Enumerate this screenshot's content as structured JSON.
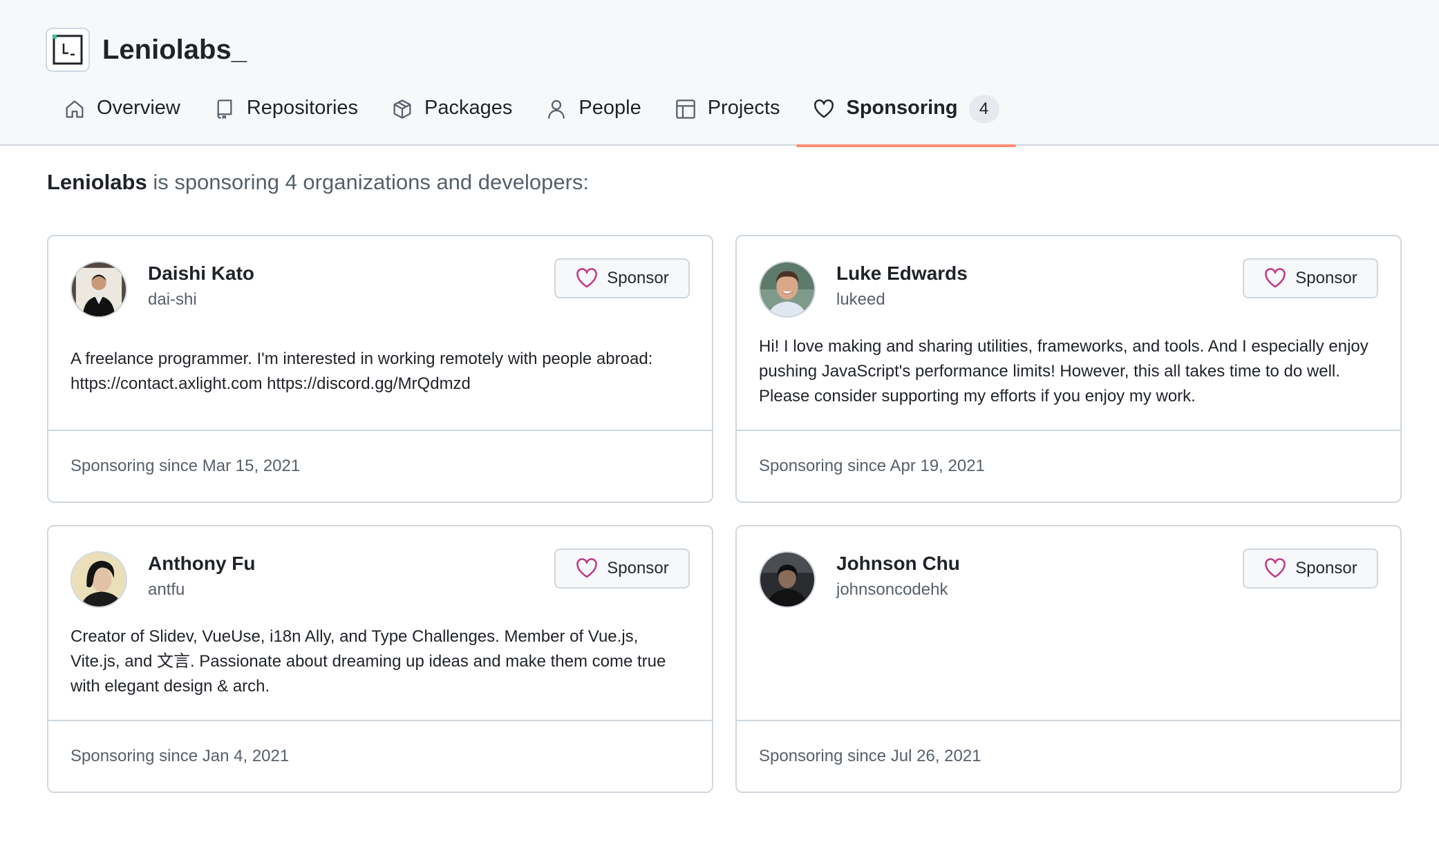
{
  "org": {
    "name": "Leniolabs_"
  },
  "tabs": [
    {
      "label": "Overview",
      "icon": "home-icon"
    },
    {
      "label": "Repositories",
      "icon": "repo-icon"
    },
    {
      "label": "Packages",
      "icon": "package-icon"
    },
    {
      "label": "People",
      "icon": "person-icon"
    },
    {
      "label": "Projects",
      "icon": "table-icon"
    },
    {
      "label": "Sponsoring",
      "icon": "heart-icon",
      "count": "4",
      "active": true
    }
  ],
  "intro": {
    "org_name": "Leniolabs",
    "text": " is sponsoring 4 organizations and developers:"
  },
  "colors": {
    "accent": "#fd8c73",
    "heart": "#bf3989",
    "muted": "#57606a"
  },
  "sponsor_button_label": "Sponsor",
  "sponsorships": [
    {
      "name": "Daishi Kato",
      "login": "dai-shi",
      "bio": "A freelance programmer. I'm interested in working remotely with people abroad: https://contact.axlight.com https://discord.gg/MrQdmzd",
      "since": "Sponsoring since Mar 15, 2021"
    },
    {
      "name": "Luke Edwards",
      "login": "lukeed",
      "bio": "Hi! I love making and sharing utilities, frameworks, and tools. And I especially enjoy pushing JavaScript's performance limits! However, this all takes time to do well. Please consider supporting my efforts if you enjoy my work.",
      "since": "Sponsoring since Apr 19, 2021"
    },
    {
      "name": "Anthony Fu",
      "login": "antfu",
      "bio": "Creator of Slidev, VueUse, i18n Ally, and Type Challenges. Member of Vue.js, Vite.js, and 文言. Passionate about dreaming up ideas and make them come true with elegant design & arch.",
      "since": "Sponsoring since Jan 4, 2021"
    },
    {
      "name": "Johnson Chu",
      "login": "johnsoncodehk",
      "bio": "",
      "since": "Sponsoring since Jul 26, 2021"
    }
  ]
}
